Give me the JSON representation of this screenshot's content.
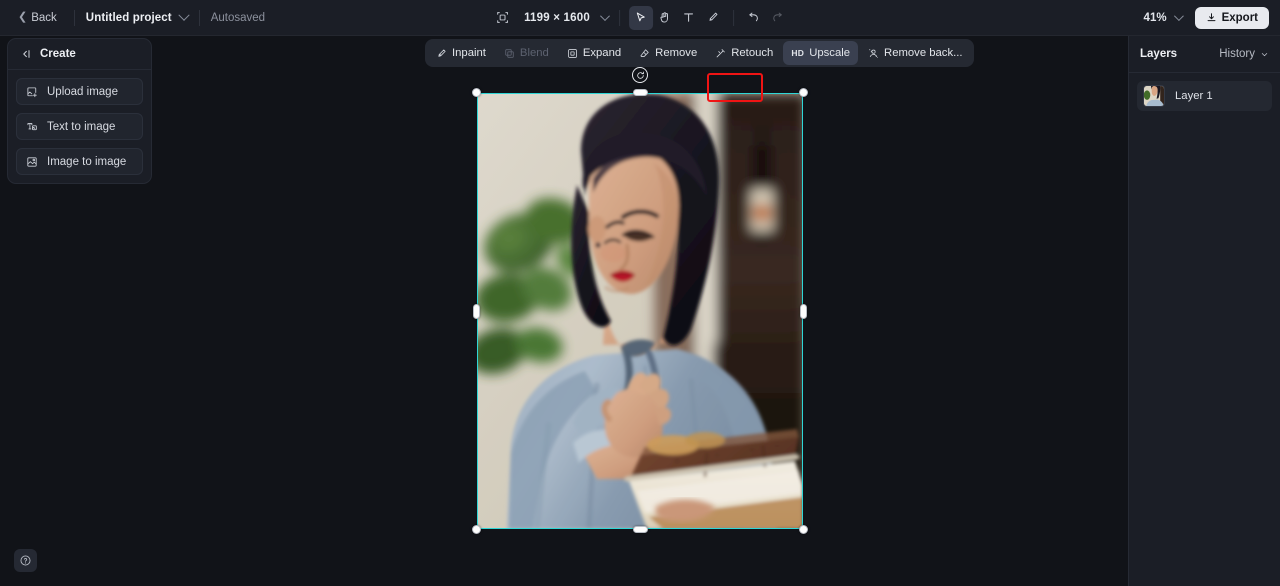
{
  "topbar": {
    "back_label": "Back",
    "project_name": "Untitled project",
    "autosaved_label": "Autosaved",
    "canvas_size": "1199 × 1600",
    "resize_icon": "resize-icon",
    "tools": [
      {
        "name": "select-tool",
        "icon": "cursor-icon",
        "active": true
      },
      {
        "name": "hand-tool",
        "icon": "hand-icon",
        "active": false
      },
      {
        "name": "text-tool",
        "icon": "text-icon",
        "active": false
      },
      {
        "name": "brush-tool",
        "icon": "brush-icon",
        "active": false
      },
      {
        "name": "undo",
        "icon": "undo-icon",
        "active": false
      },
      {
        "name": "redo",
        "icon": "redo-icon",
        "active": false
      }
    ],
    "zoom_level": "41%",
    "export_label": "Export",
    "export_icon": "download-icon"
  },
  "left_panel": {
    "title": "Create",
    "collapse_icon": "collapse-panel-icon",
    "items": [
      {
        "label": "Upload image",
        "icon": "upload-image-icon"
      },
      {
        "label": "Text to image",
        "icon": "text-to-image-icon"
      },
      {
        "label": "Image to image",
        "icon": "image-to-image-icon"
      }
    ]
  },
  "action_bar": {
    "items": [
      {
        "label": "Inpaint",
        "icon": "inpaint-icon",
        "disabled": false,
        "selected": false
      },
      {
        "label": "Blend",
        "icon": "blend-icon",
        "disabled": true,
        "selected": false
      },
      {
        "label": "Expand",
        "icon": "expand-icon",
        "disabled": false,
        "selected": false
      },
      {
        "label": "Remove",
        "icon": "remove-icon",
        "disabled": false,
        "selected": false
      },
      {
        "label": "Retouch",
        "icon": "retouch-icon",
        "disabled": false,
        "selected": false
      },
      {
        "label": "Upscale",
        "icon": "hd-icon",
        "disabled": false,
        "selected": true
      },
      {
        "label": "Remove back...",
        "icon": "remove-background-icon",
        "disabled": false,
        "selected": false
      }
    ],
    "highlight_color": "#f01414",
    "highlighted_item": "Upscale"
  },
  "canvas": {
    "background": "#111318",
    "selection_color": "#2fd6d6",
    "rotate_icon": "rotate-icon",
    "image_alt": "Woman in light blue blouse holding a tiramisu dessert"
  },
  "right_panel": {
    "title": "Layers",
    "history_label": "History",
    "history_icon": "chevron-down-icon",
    "layers": [
      {
        "name": "Layer 1",
        "thumbnail": "layer-thumbnail"
      }
    ]
  },
  "help": {
    "icon": "help-circle-icon",
    "label": "?"
  }
}
